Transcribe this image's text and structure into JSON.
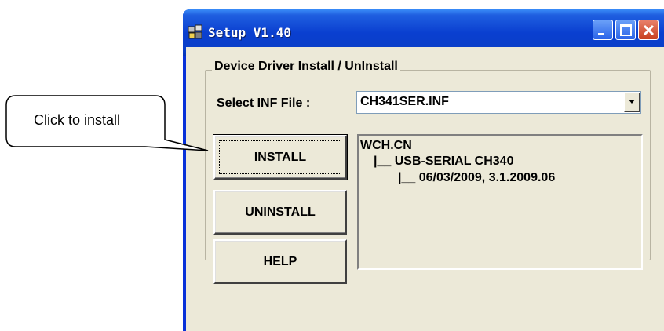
{
  "callout": {
    "text": "Click to install"
  },
  "window": {
    "title": "Setup V1.40",
    "icon": "setup-app-icon",
    "controls": [
      "minimize-icon",
      "maximize-icon",
      "close-icon"
    ]
  },
  "group": {
    "legend": "Device Driver Install / UnInstall",
    "inf_label": "Select INF File :",
    "inf_value": "CH341SER.INF"
  },
  "buttons": {
    "install": "INSTALL",
    "uninstall": "UNINSTALL",
    "help": "HELP"
  },
  "driver_info": {
    "line1": "WCH.CN",
    "line2": "|__ USB-SERIAL CH340",
    "line3": "|__ 06/03/2009, 3.1.2009.06"
  }
}
